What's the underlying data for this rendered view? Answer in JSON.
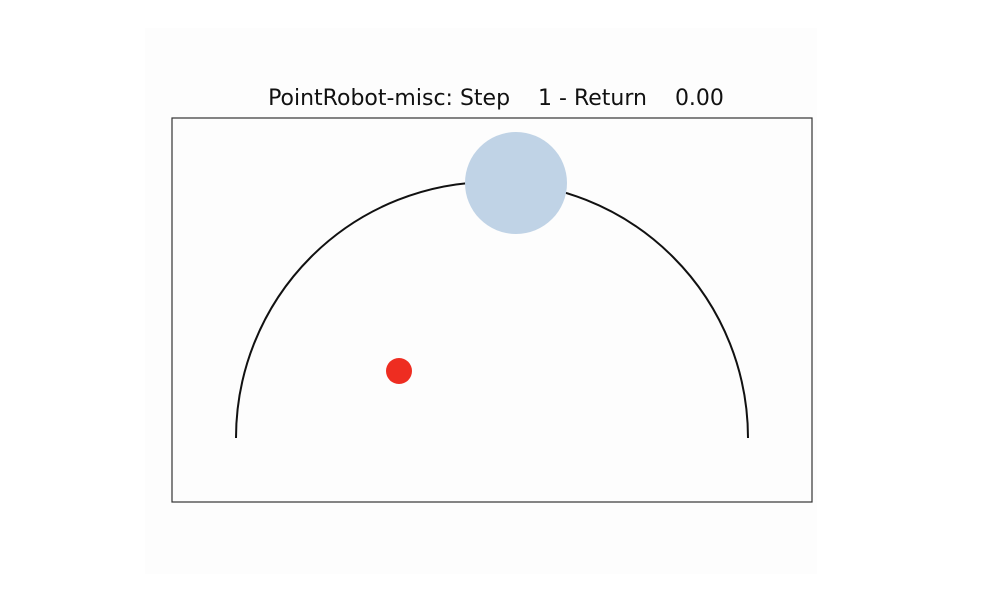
{
  "title": {
    "prefix": "PointRobot-misc: Step",
    "step": "1",
    "separator": " - Return",
    "return_value": "0.00"
  },
  "scene": {
    "arc": {
      "shape": "semicircle",
      "color": "#111111"
    },
    "goal": {
      "shape": "circle",
      "color": "#c0d3e6"
    },
    "agent": {
      "shape": "circle",
      "color": "#ee2d21"
    },
    "frame_color": "#333333"
  }
}
